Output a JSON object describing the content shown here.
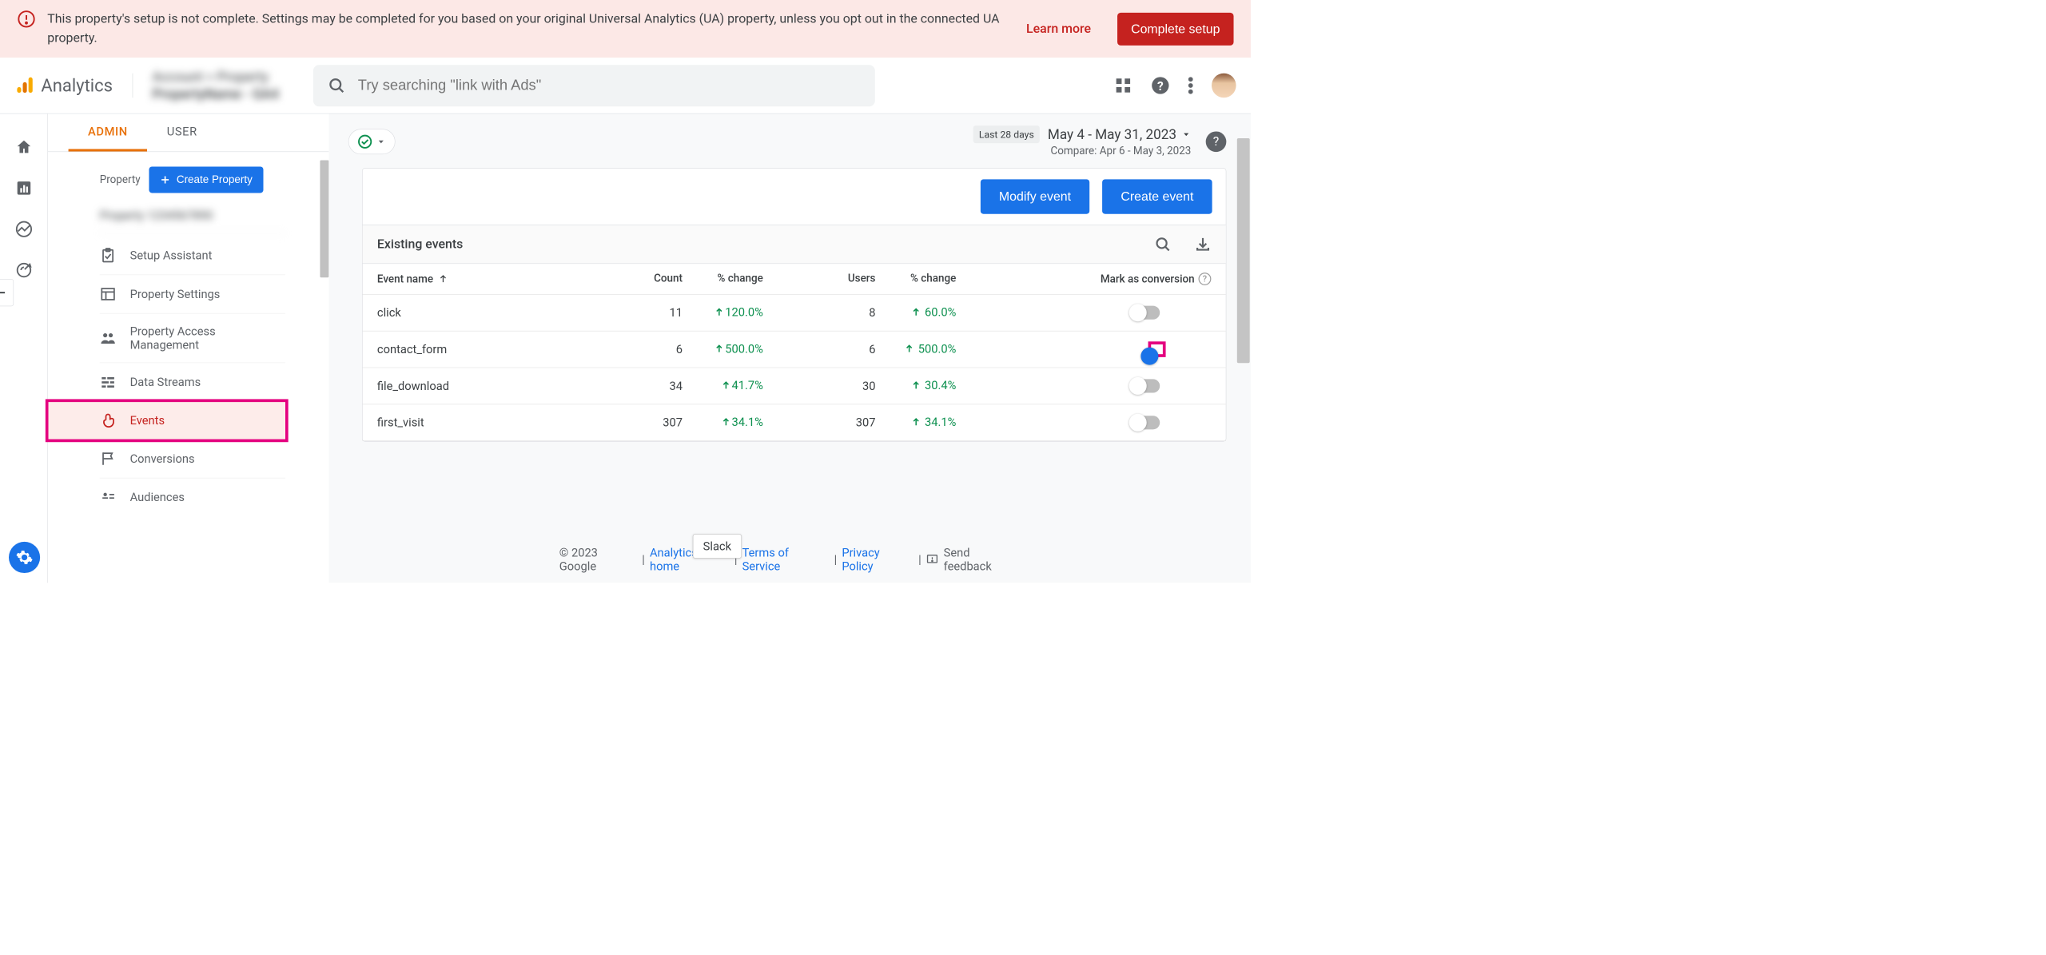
{
  "banner": {
    "text": "This property's setup is not complete. Settings may be completed for you based on your original Universal Analytics (UA) property, unless you opt out in the connected UA property.",
    "learn_more": "Learn more",
    "complete_setup": "Complete setup"
  },
  "header": {
    "logo_text": "Analytics",
    "property_line1": "Account > Property",
    "property_line2": "PropertyName - GA4",
    "search_placeholder": "Try searching \"link with Ads\""
  },
  "tabs": {
    "admin": "ADMIN",
    "user": "USER"
  },
  "property_panel": {
    "label": "Property",
    "create_button": "Create Property",
    "property_name": "Property 1234567890",
    "nav": {
      "setup_assistant": "Setup Assistant",
      "property_settings": "Property Settings",
      "property_access": "Property Access Management",
      "data_streams": "Data Streams",
      "events": "Events",
      "conversions": "Conversions",
      "audiences": "Audiences"
    }
  },
  "date": {
    "badge": "Last 28 days",
    "range": "May 4 - May 31, 2023",
    "compare": "Compare: Apr 6 - May 3, 2023"
  },
  "card": {
    "modify": "Modify event",
    "create": "Create event",
    "title": "Existing events",
    "columns": {
      "name": "Event name",
      "count": "Count",
      "change1": "% change",
      "users": "Users",
      "change2": "% change",
      "mark": "Mark as conversion"
    },
    "rows": [
      {
        "name": "click",
        "count": "11",
        "change1": "120.0%",
        "users": "8",
        "change2": "60.0%",
        "on": false
      },
      {
        "name": "contact_form",
        "count": "6",
        "change1": "500.0%",
        "users": "6",
        "change2": "500.0%",
        "on": true,
        "highlighted": true
      },
      {
        "name": "file_download",
        "count": "34",
        "change1": "41.7%",
        "users": "30",
        "change2": "30.4%",
        "on": false
      },
      {
        "name": "first_visit",
        "count": "307",
        "change1": "34.1%",
        "users": "307",
        "change2": "34.1%",
        "on": false
      }
    ]
  },
  "footer": {
    "copyright": "© 2023 Google",
    "analytics_home": "Analytics home",
    "terms": "Terms of Service",
    "privacy": "Privacy Policy",
    "feedback": "Send feedback"
  },
  "popup": {
    "slack": "Slack"
  }
}
